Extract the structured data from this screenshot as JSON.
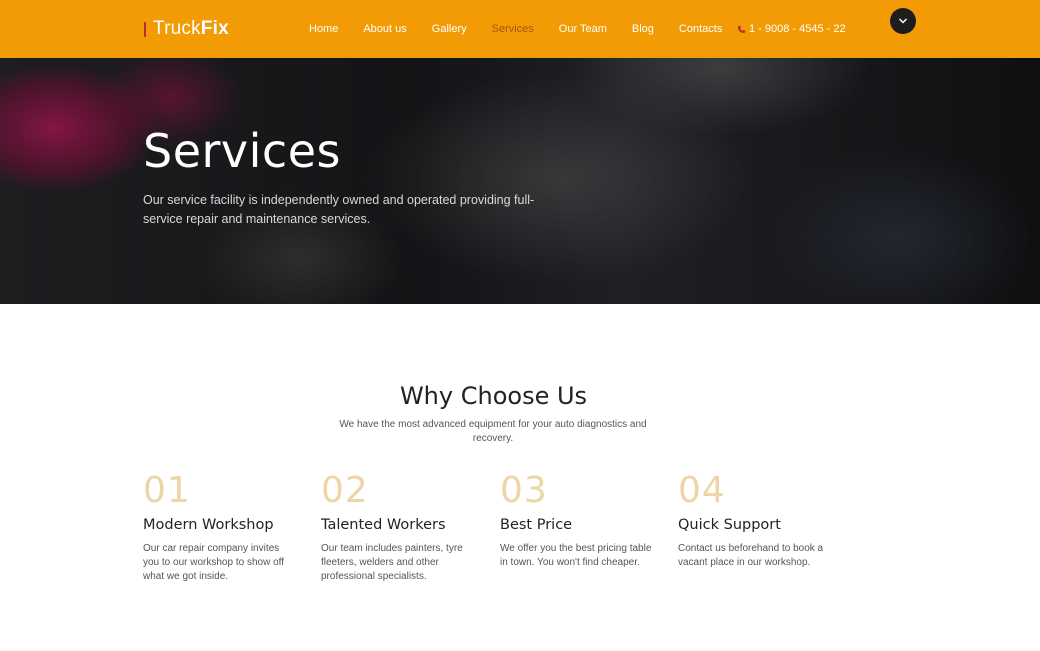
{
  "header": {
    "logo_a": "Truck",
    "logo_b": "Fix",
    "nav": [
      "Home",
      "About us",
      "Gallery",
      "Services",
      "Our Team",
      "Blog",
      "Contacts"
    ],
    "active_nav": "Services",
    "phone": "1 - 9008 - 4545 - 22",
    "menu_icon": "chevron-down-icon",
    "accent_color": "#f29b05"
  },
  "hero": {
    "title": "Services",
    "text": "Our service facility is independently owned and operated providing full-service repair and maintenance services."
  },
  "why": {
    "title": "Why Choose Us",
    "subtitle": "We have the most advanced equipment for your auto diagnostics and recovery.",
    "features": [
      {
        "num": "01",
        "title": "Modern Workshop",
        "text": "Our car repair company invites you to our workshop to show off what we got inside."
      },
      {
        "num": "02",
        "title": "Talented Workers",
        "text": "Our team includes painters, tyre fleeters, welders and other professional specialists."
      },
      {
        "num": "03",
        "title": "Best Price",
        "text": "We offer you the best pricing table in town. You won't find cheaper."
      },
      {
        "num": "04",
        "title": "Quick Support",
        "text": "Contact us beforehand to book a vacant place in our workshop."
      }
    ]
  }
}
